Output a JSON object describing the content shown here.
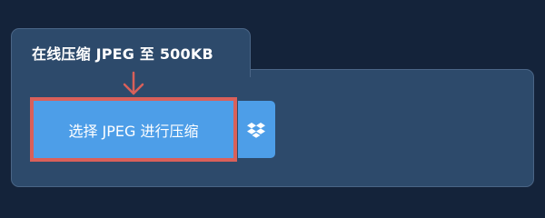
{
  "panel": {
    "title": "在线压缩 JPEG 至 500KB"
  },
  "upload": {
    "select_label": "选择 JPEG 进行压缩",
    "dropbox_icon": "dropbox-icon"
  },
  "colors": {
    "background": "#14233a",
    "panel": "#2d4a6b",
    "button": "#4d9ee8",
    "highlight": "#d9605a"
  }
}
